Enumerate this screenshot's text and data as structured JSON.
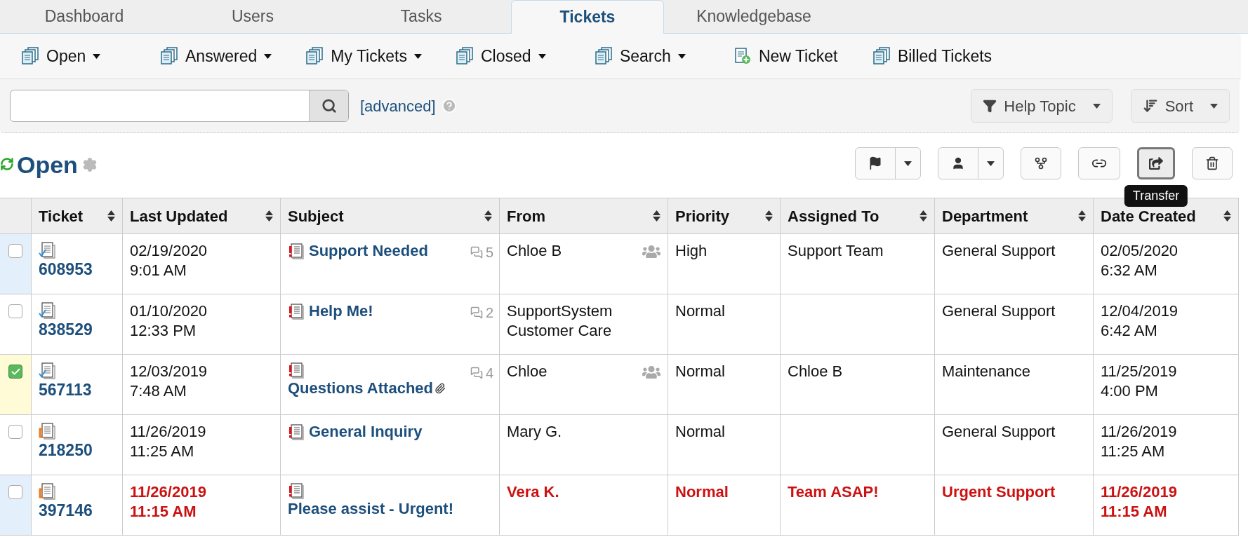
{
  "tabs": [
    {
      "label": "Dashboard",
      "selected": false
    },
    {
      "label": "Users",
      "selected": false
    },
    {
      "label": "Tasks",
      "selected": false
    },
    {
      "label": "Tickets",
      "selected": true
    },
    {
      "label": "Knowledgebase",
      "selected": false
    }
  ],
  "subnav": [
    {
      "label": "Open",
      "kind": "list",
      "dropdown": true
    },
    {
      "label": "Answered",
      "kind": "list",
      "dropdown": true
    },
    {
      "label": "My Tickets",
      "kind": "list",
      "dropdown": true
    },
    {
      "label": "Closed",
      "kind": "list",
      "dropdown": true
    },
    {
      "label": "Search",
      "kind": "list",
      "dropdown": true
    },
    {
      "label": "New Ticket",
      "kind": "new",
      "dropdown": false
    },
    {
      "label": "Billed Tickets",
      "kind": "list",
      "dropdown": false
    }
  ],
  "search": {
    "advanced_link": "[advanced]"
  },
  "filters": [
    {
      "label": "Help Topic",
      "kind": "filter"
    },
    {
      "label": "Sort",
      "kind": "sort"
    }
  ],
  "title": "Open",
  "actions": [
    {
      "kind": "flag",
      "split": true,
      "active": false
    },
    {
      "kind": "user",
      "split": true,
      "active": false
    },
    {
      "kind": "fork",
      "split": false,
      "active": false
    },
    {
      "kind": "link",
      "split": false,
      "active": false
    },
    {
      "kind": "transfer",
      "split": false,
      "active": true,
      "tooltip": "Transfer"
    },
    {
      "kind": "trash",
      "split": false,
      "active": false
    }
  ],
  "table": {
    "columns": [
      "Ticket",
      "Last Updated",
      "Subject",
      "From",
      "Priority",
      "Assigned To",
      "Department",
      "Date Created"
    ],
    "rows": [
      {
        "checked": false,
        "highlighted": true,
        "kind": "tick",
        "ticket": "608953",
        "last_updated": [
          "02/19/2020",
          "9:01 AM"
        ],
        "subject": "Support Needed",
        "thread_count": "5",
        "attachment": false,
        "from": "Chloe B",
        "group": true,
        "priority": "High",
        "assigned_to": "Support Team",
        "department": "General Support",
        "date_created": [
          "02/05/2020",
          "6:32 AM"
        ],
        "overdue": false
      },
      {
        "checked": false,
        "highlighted": false,
        "kind": "tick",
        "ticket": "838529",
        "last_updated": [
          "01/10/2020",
          "12:33 PM"
        ],
        "subject": "Help Me!",
        "thread_count": "2",
        "attachment": false,
        "from": "SupportSystem Customer Care",
        "group": false,
        "priority": "Normal",
        "department": "General Support",
        "date_created": [
          "12/04/2019",
          "6:42 AM"
        ],
        "overdue": false
      },
      {
        "checked": true,
        "highlighted": false,
        "kind": "tick",
        "ticket": "567113",
        "last_updated": [
          "12/03/2019",
          "7:48 AM"
        ],
        "subject": "Questions Attached",
        "thread_count": "4",
        "attachment": true,
        "from": "Chloe",
        "group": true,
        "priority": "Normal",
        "assigned_to": "Chloe B",
        "department": "Maintenance",
        "date_created": [
          "11/25/2019",
          "4:00 PM"
        ],
        "overdue": false
      },
      {
        "checked": false,
        "highlighted": false,
        "kind": "bracket",
        "ticket": "218250",
        "last_updated": [
          "11/26/2019",
          "11:25 AM"
        ],
        "subject": "General Inquiry",
        "attachment": false,
        "from": "Mary G.",
        "group": false,
        "priority": "Normal",
        "department": "General Support",
        "date_created": [
          "11/26/2019",
          "11:25 AM"
        ],
        "overdue": false
      },
      {
        "checked": false,
        "highlighted": true,
        "kind": "bracket",
        "ticket": "397146",
        "last_updated": [
          "11/26/2019",
          "11:15 AM"
        ],
        "subject": "Please assist - Urgent!",
        "attachment": false,
        "from": "Vera K.",
        "group": false,
        "priority": "Normal",
        "assigned_to": "Team ASAP!",
        "department": "Urgent Support",
        "date_created": [
          "11/26/2019",
          "11:15 AM"
        ],
        "overdue": true
      }
    ]
  }
}
